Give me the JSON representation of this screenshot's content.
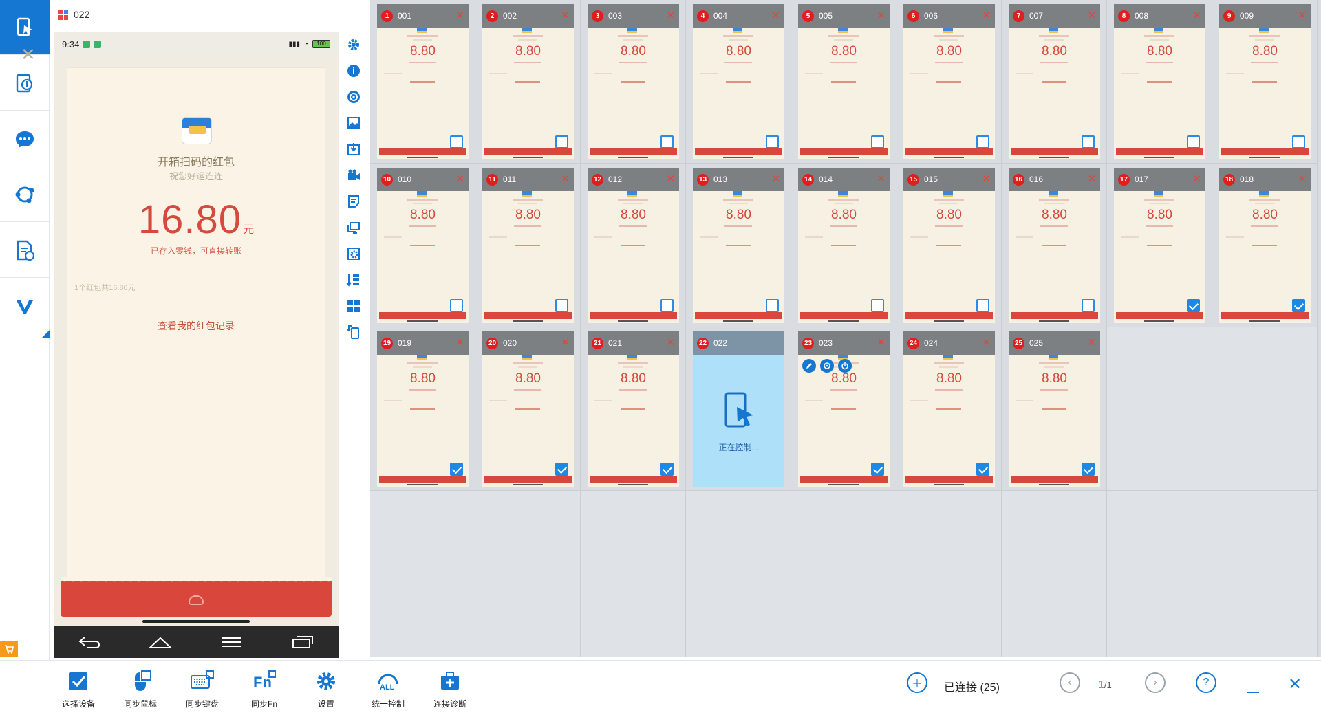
{
  "window": {
    "title": "022"
  },
  "colors": {
    "accent": "#1677d2",
    "red": "#d9463b",
    "badge": "#e11d1d",
    "orange": "#f07d1a"
  },
  "sidebar": {
    "items": [
      {
        "name": "screen-control-icon",
        "active": true
      },
      {
        "name": "device-info-icon"
      },
      {
        "name": "chat-icon"
      },
      {
        "name": "sync-icon"
      },
      {
        "name": "file-sync-icon"
      },
      {
        "name": "brand-v-icon"
      }
    ]
  },
  "phone": {
    "status": {
      "time": "9:34",
      "battery": "100"
    },
    "envelope": {
      "title": "开箱扫码的红包",
      "subtitle": "祝您好运连连",
      "amount": "16.80",
      "unit": "元",
      "note": "已存入零钱，可直接转账",
      "count": "1个红包共16.80元",
      "link": "查看我的红包记录"
    }
  },
  "tools": [
    "settings-icon",
    "info-icon",
    "target-icon",
    "screenshot-icon",
    "upload-icon",
    "record-icon",
    "notes-icon",
    "screen-cast-icon",
    "advanced-settings-icon",
    "download-icon",
    "keypad-icon",
    "rotate-icon"
  ],
  "grid": {
    "thumb_amount": "8.80",
    "controlling_text": "正在控制...",
    "devices": [
      {
        "no": "1",
        "name": "001",
        "checked": false
      },
      {
        "no": "2",
        "name": "002",
        "checked": false
      },
      {
        "no": "3",
        "name": "003",
        "checked": false
      },
      {
        "no": "4",
        "name": "004",
        "checked": false
      },
      {
        "no": "5",
        "name": "005",
        "checked": false
      },
      {
        "no": "6",
        "name": "006",
        "checked": false
      },
      {
        "no": "7",
        "name": "007",
        "checked": false
      },
      {
        "no": "8",
        "name": "008",
        "checked": false
      },
      {
        "no": "9",
        "name": "009",
        "checked": false
      },
      {
        "no": "10",
        "name": "010",
        "checked": false
      },
      {
        "no": "11",
        "name": "011",
        "checked": false
      },
      {
        "no": "12",
        "name": "012",
        "checked": false
      },
      {
        "no": "13",
        "name": "013",
        "checked": false
      },
      {
        "no": "14",
        "name": "014",
        "checked": false
      },
      {
        "no": "15",
        "name": "015",
        "checked": false
      },
      {
        "no": "16",
        "name": "016",
        "checked": false
      },
      {
        "no": "17",
        "name": "017",
        "checked": true
      },
      {
        "no": "18",
        "name": "018",
        "checked": true
      },
      {
        "no": "19",
        "name": "019",
        "checked": true
      },
      {
        "no": "20",
        "name": "020",
        "checked": true
      },
      {
        "no": "21",
        "name": "021",
        "checked": true
      },
      {
        "no": "22",
        "name": "022",
        "controlling": true
      },
      {
        "no": "23",
        "name": "023",
        "checked": true,
        "tools": true
      },
      {
        "no": "24",
        "name": "024",
        "checked": true
      },
      {
        "no": "25",
        "name": "025",
        "checked": true
      }
    ]
  },
  "bottombar": {
    "buttons": [
      {
        "name": "select-devices-button",
        "icon": "checkbox-icon",
        "label": "选择设备"
      },
      {
        "name": "sync-mouse-button",
        "icon": "mouse-icon",
        "label": "同步鼠标"
      },
      {
        "name": "sync-keyboard-button",
        "icon": "keyboard-icon",
        "label": "同步键盘"
      },
      {
        "name": "sync-fn-button",
        "icon": "fn-icon",
        "label": "同步Fn"
      },
      {
        "name": "settings-button",
        "icon": "gear-icon",
        "label": "设置"
      },
      {
        "name": "unified-control-button",
        "icon": "all-icon",
        "label": "统一控制"
      },
      {
        "name": "diagnose-button",
        "icon": "toolbox-icon",
        "label": "连接诊断"
      }
    ],
    "connected": "已连接 (25)",
    "page_current": "1",
    "page_total": "/1"
  }
}
